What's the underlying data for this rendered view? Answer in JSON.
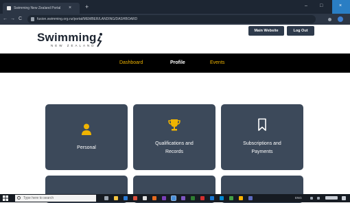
{
  "browser": {
    "tab_title": "Swimming New Zealand Portal",
    "tab_close": "×",
    "new_tab": "+",
    "url": "fusion.swimming.org.nz/portal/MEMBER/LANDING/DASHBOARD",
    "window_controls": [
      "–",
      "□"
    ],
    "window_close": "×",
    "nav": [
      "←",
      "→",
      "C"
    ]
  },
  "header": {
    "logo_text": "Swimming",
    "logo_subtext": "NEW ZEALAND",
    "main_website_label": "Main Website",
    "logout_label": "Log Out"
  },
  "nav": {
    "items": [
      {
        "label": "Dashboard"
      },
      {
        "label": "Profile"
      },
      {
        "label": "Events"
      }
    ],
    "active": "Profile"
  },
  "cards": [
    {
      "label": "Personal",
      "icon": "person-icon"
    },
    {
      "label_line1": "Qualifications and",
      "label_line2": "Records",
      "icon": "trophy-icon"
    },
    {
      "label_line1": "Subscriptions and",
      "label_line2": "Payments",
      "icon": "bookmark-icon"
    }
  ],
  "taskbar": {
    "search_placeholder": "Type here to search",
    "tray_text": "ENG"
  },
  "colors": {
    "nav_bg": "#000000",
    "nav_text": "#f0b400",
    "card_bg": "#3c495a",
    "card_icon": "#f0b400",
    "button_bg": "#2e3a4b"
  }
}
